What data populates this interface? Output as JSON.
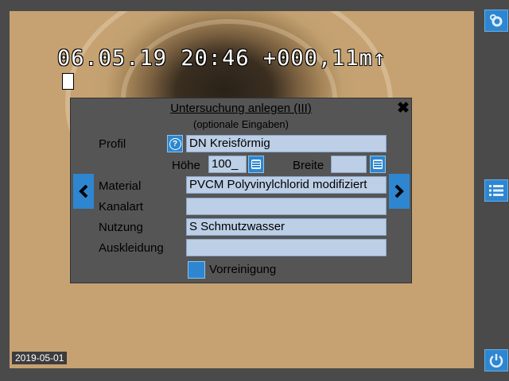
{
  "camera": {
    "osd_text": "06.05.19 20:46 +000,11m↑",
    "date_badge": "2019-05-01"
  },
  "sidebar": {
    "settings_icon": "gear-icon",
    "menu_icon": "list-icon",
    "power_icon": "power-icon",
    "accent_color": "#2e86d0"
  },
  "dialog": {
    "title": "Untersuchung anlegen (III)",
    "subtitle": "(optionale Eingaben)",
    "close_label": "✖",
    "profil_label": "Profil",
    "profil_help": "?",
    "profil_value": "DN Kreisförmig",
    "hoehe_label": "Höhe",
    "hoehe_value": "100_",
    "breite_label": "Breite",
    "breite_value": "",
    "material_label": "Material",
    "material_value": "PVCM Polyvinylchlorid modifiziert",
    "kanalart_label": "Kanalart",
    "kanalart_value": "",
    "nutzung_label": "Nutzung",
    "nutzung_value": "S Schmutzwasser",
    "auskleidung_label": "Auskleidung",
    "auskleidung_value": "",
    "vorreinigung_label": "Vorreinigung",
    "field_color": "#bccfe6"
  }
}
